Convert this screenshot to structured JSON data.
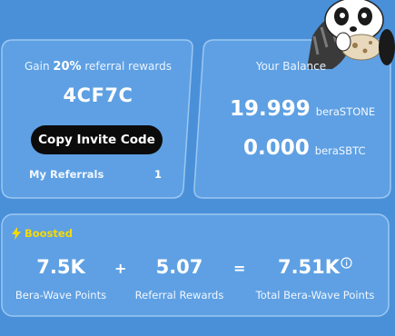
{
  "referral": {
    "tagline_prefix": "Gain",
    "tagline_percent": "20%",
    "tagline_suffix": "referral rewards",
    "code": "4CF7C",
    "copy_button": "Copy Invite Code",
    "my_referrals_label": "My Referrals",
    "my_referrals_count": "1"
  },
  "balance": {
    "title": "Your Balance",
    "rows": [
      {
        "value": "19.999",
        "unit": "beraSTONE"
      },
      {
        "value": "0.000",
        "unit": "beraSBTC"
      }
    ]
  },
  "boosted": {
    "badge": "Boosted",
    "badge_icon": "lightning-icon",
    "stats": [
      {
        "value": "7.5K",
        "label": "Bera-Wave Points"
      },
      {
        "value": "5.07",
        "label": "Referral Rewards"
      },
      {
        "value": "7.51K",
        "label": "Total Bera-Wave Points"
      }
    ],
    "op_plus": "+",
    "op_equals": "="
  },
  "colors": {
    "background": "#4a90d9",
    "card_fill": "#5ea0e3",
    "card_border": "#9cc7f2",
    "button": "#0b0b0b",
    "boost_accent": "#f5d90a"
  }
}
